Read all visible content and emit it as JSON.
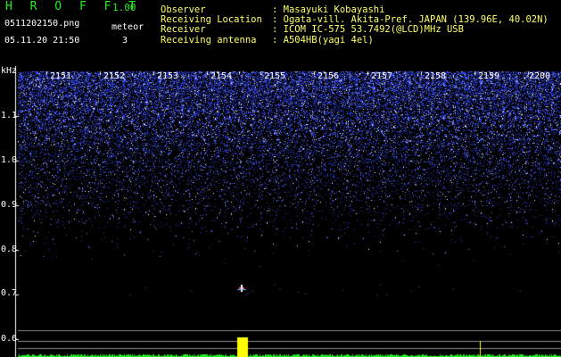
{
  "app": {
    "title": "H R O F F T",
    "version": "1.00"
  },
  "file": {
    "name": "0511202150.png",
    "datetime": "05.11.20 21:50"
  },
  "meteor": {
    "label": "meteor",
    "count": "3"
  },
  "info": [
    {
      "label": "Observer",
      "value": ": Masayuki Kobayashi"
    },
    {
      "label": "Receiving Location",
      "value": ": Ogata-vill. Akita-Pref. JAPAN (139.96E, 40.02N)"
    },
    {
      "label": "Receiver",
      "value": ": ICOM IC-575 53.7492(@LCD)MHz USB"
    },
    {
      "label": "Receiving antenna",
      "value": ": A504HB(yagi 4el)"
    }
  ],
  "axis": {
    "unit": "kHz",
    "time_ticks": [
      "2151",
      "2152",
      "2153",
      "2154",
      "2155",
      "2156",
      "2157",
      "2158",
      "2159",
      "2200"
    ],
    "freq_ticks": [
      "1.1",
      "1.0",
      "0.9",
      "0.8",
      "0.7",
      "0.6"
    ]
  },
  "colors": {
    "green": "#22ee22",
    "plot_bg": "#000000",
    "noise": "#3a4cff"
  }
}
